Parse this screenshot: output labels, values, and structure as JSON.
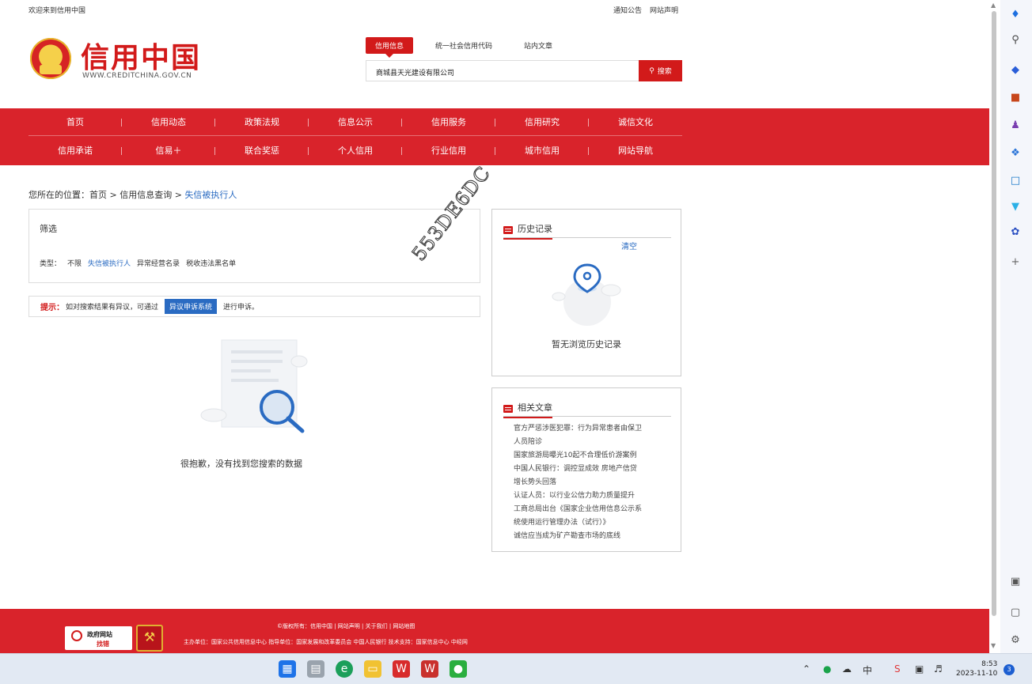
{
  "topbar": {
    "welcome": "欢迎来到信用中国",
    "notice": "通知公告",
    "statement": "网站声明"
  },
  "logo": {
    "name": "信用中国",
    "url": "WWW.CREDITCHINA.GOV.CN"
  },
  "search": {
    "tabs": [
      "信用信息",
      "统一社会信用代码",
      "站内文章"
    ],
    "query": "商城县天光建设有限公司",
    "button": "搜索"
  },
  "nav": {
    "row1": [
      "首页",
      "信用动态",
      "政策法规",
      "信息公示",
      "信用服务",
      "信用研究",
      "诚信文化"
    ],
    "row2": [
      "信用承诺",
      "信易＋",
      "联合奖惩",
      "个人信用",
      "行业信用",
      "城市信用",
      "网站导航"
    ]
  },
  "breadcrumb": {
    "prefix": "您所在的位置：",
    "home": "首页",
    "sep1": ">",
    "query": "信用信息查询",
    "sep2": ">",
    "current": "失信被执行人"
  },
  "filter": {
    "title": "筛选",
    "type_label": "类型：",
    "types": [
      "不限",
      "失信被执行人",
      "异常经营名录",
      "税收违法黑名单"
    ]
  },
  "tip": {
    "label": "提示：",
    "text1": "如对搜索结果有异议，可通过",
    "button": "异议申诉系统",
    "text2": "进行申诉。"
  },
  "empty": {
    "message": "很抱歉，没有找到您搜索的数据"
  },
  "history": {
    "title": "历史记录",
    "clear": "清空",
    "empty": "暂无浏览历史记录"
  },
  "related": {
    "title": "相关文章",
    "articles": [
      "官方严惩涉医犯罪：行为异常患者由保卫",
      "人员陪诊",
      "国家旅游局曝光10起不合理低价游案例",
      "中国人民银行：调控显成效 房地产信贷",
      "增长势头回落",
      "认证人员：以行业公信力助力质量提升",
      "工商总局出台《国家企业信用信息公示系",
      "统使用运行管理办法（试行）》",
      "诚信应当成为矿产勘查市场的底线"
    ]
  },
  "footer": {
    "line1": "©版权所有：信用中国 | 网站声明 | 关于我们 | 网站地图",
    "line2": "主办单位：国家公共信用信息中心  指导单位：国家发展和改革委员会 中国人民银行  技术支持：国家信息中心 中经网",
    "badge_text1": "政府网站",
    "badge_text2": "找错"
  },
  "watermark": "553DE6DC",
  "taskbar": {
    "time": "8:53",
    "date": "2023-11-10",
    "notif_count": "3",
    "ime": "中"
  },
  "colors": {
    "brand_red": "#d9232b",
    "link_blue": "#2a6bc2"
  }
}
